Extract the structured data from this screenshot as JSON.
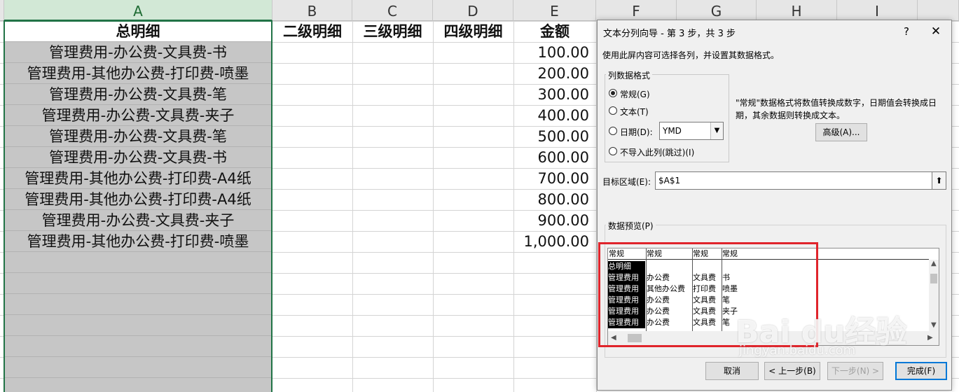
{
  "sheet": {
    "columns": [
      "A",
      "B",
      "C",
      "D",
      "E",
      "F",
      "G",
      "H",
      "I"
    ],
    "headers": {
      "A": "总明细",
      "B": "二级明细",
      "C": "三级明细",
      "D": "四级明细",
      "E": "金额"
    },
    "rows": [
      {
        "a": "管理费用-办公费-文具费-书",
        "e": "100.00"
      },
      {
        "a": "管理费用-其他办公费-打印费-喷墨",
        "e": "200.00"
      },
      {
        "a": "管理费用-办公费-文具费-笔",
        "e": "300.00"
      },
      {
        "a": "管理费用-办公费-文具费-夹子",
        "e": "400.00"
      },
      {
        "a": "管理费用-办公费-文具费-笔",
        "e": "500.00"
      },
      {
        "a": "管理费用-办公费-文具费-书",
        "e": "600.00"
      },
      {
        "a": "管理费用-其他办公费-打印费-A4纸",
        "e": "700.00"
      },
      {
        "a": "管理费用-其他办公费-打印费-A4纸",
        "e": "800.00"
      },
      {
        "a": "管理费用-办公费-文具费-夹子",
        "e": "900.00"
      },
      {
        "a": "管理费用-其他办公费-打印费-喷墨",
        "e": "1,000.00"
      }
    ]
  },
  "dialog": {
    "title": "文本分列向导 - 第 3 步，共 3 步",
    "help": "?",
    "close": "✕",
    "instruction": "使用此屏内容可选择各列，并设置其数据格式。",
    "format_group": "列数据格式",
    "radio_general": "常规(G)",
    "radio_text": "文本(T)",
    "radio_date": "日期(D):",
    "radio_skip": "不导入此列(跳过)(I)",
    "date_format": "YMD",
    "desc_line1": "\"常规\"数据格式将数值转换成数字，日期值会转换成日",
    "desc_line2": "期，其余数据则转换成文本。",
    "advanced_button": "高级(A)...",
    "dest_label": "目标区域(E):",
    "dest_value": "$A$1",
    "preview_label": "数据预览(P)",
    "preview_headers": [
      "常规",
      "常规",
      "常规",
      "常规"
    ],
    "preview_rows": [
      [
        "总明细",
        "",
        "",
        ""
      ],
      [
        "管理费用",
        "办公费",
        "文具费",
        "书"
      ],
      [
        "管理费用",
        "其他办公费",
        "打印费",
        "喷墨"
      ],
      [
        "管理费用",
        "办公费",
        "文具费",
        "笔"
      ],
      [
        "管理费用",
        "办公费",
        "文具费",
        "夹子"
      ],
      [
        "管理费用",
        "办公费",
        "文具费",
        "笔"
      ]
    ],
    "cancel_button": "取消",
    "back_button": "< 上一步(B)",
    "next_button": "下一步(N) >",
    "finish_button": "完成(F)"
  },
  "watermark": {
    "brand": "Bai du经验",
    "url": "jingyan.baidu.com"
  },
  "colors": {
    "selection_green": "#217346",
    "highlight_red": "#e0242b"
  }
}
